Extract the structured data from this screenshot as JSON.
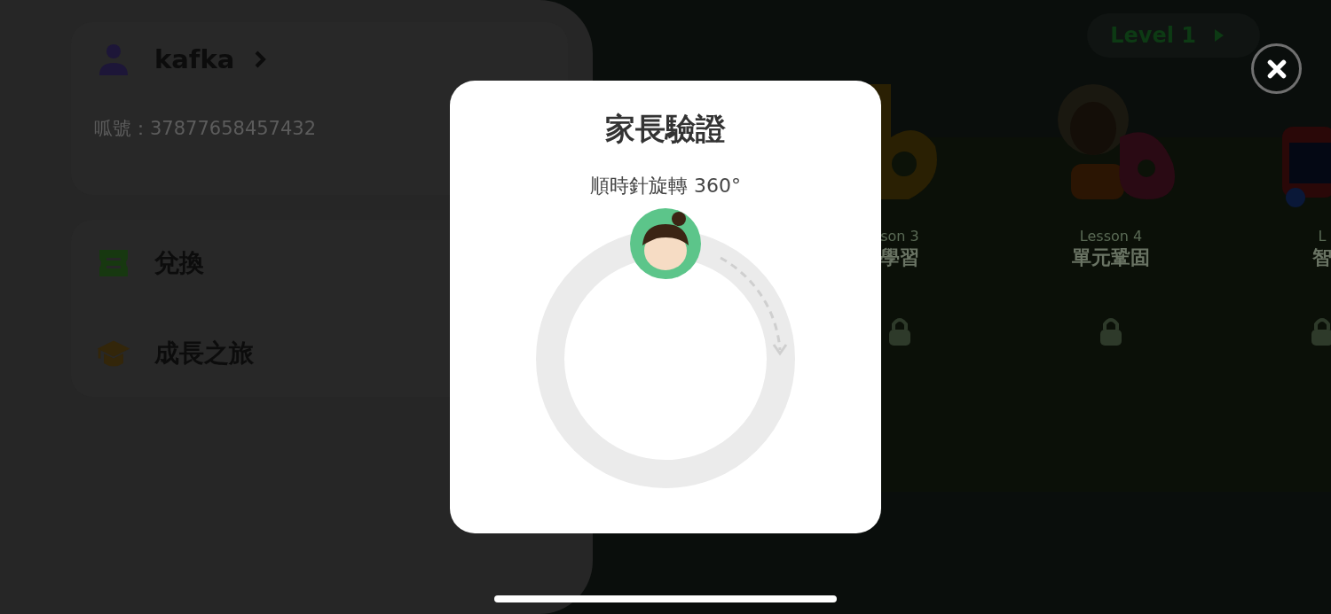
{
  "profile": {
    "name": "kafka",
    "account": "呱號：37877658457432"
  },
  "menu": [
    {
      "kind": "redeem",
      "label": "兌換"
    },
    {
      "kind": "journey",
      "label": "成長之旅"
    }
  ],
  "level_badge": {
    "label": "Level 1"
  },
  "lessons": [
    {
      "kind": "letter",
      "lesson": "son 3",
      "title": "學習"
    },
    {
      "kind": "picture",
      "lesson": "Lesson 4",
      "title": "單元鞏固"
    },
    {
      "kind": "train",
      "lesson": "L",
      "title": "智"
    }
  ],
  "dialog": {
    "title": "家長驗證",
    "instruction": "順時針旋轉 360°"
  }
}
